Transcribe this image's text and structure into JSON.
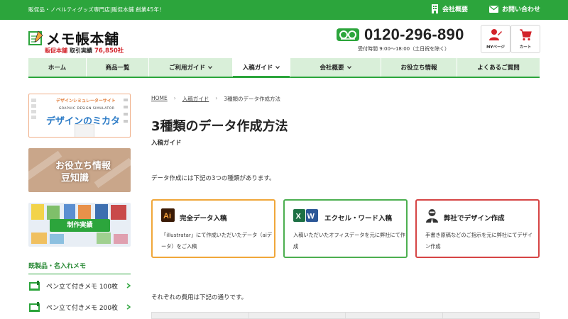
{
  "topbar": {
    "tagline": "販促品・ノベルティグッズ専門店|販促本舗 創業45年！",
    "company_link": "会社概要",
    "contact_link": "お問い合わせ"
  },
  "header": {
    "logo_title": "メモ帳本舗",
    "logo_brand": "販促本舗",
    "logo_record_label": "取引実績",
    "logo_record_count": "76,850社",
    "phone": "0120-296-890",
    "hours": "受付時間 9:00～18:00（土日祝を除く）",
    "mypage_label": "MYページ",
    "cart_label": "カート"
  },
  "nav": [
    {
      "label": "ホーム",
      "dropdown": false
    },
    {
      "label": "商品一覧",
      "dropdown": false
    },
    {
      "label": "ご利用ガイド",
      "dropdown": true
    },
    {
      "label": "入稿ガイド",
      "dropdown": true,
      "active": true
    },
    {
      "label": "会社概要",
      "dropdown": true
    },
    {
      "label": "お役立ち情報",
      "dropdown": false
    },
    {
      "label": "よくあるご質問",
      "dropdown": false
    }
  ],
  "sidebar": {
    "banner_design": {
      "top": "デザインシミュレーターサイト",
      "en": "GRAPHIC DESIGN SIMULATOR",
      "title": "デザインのミカタ"
    },
    "banner_tips": {
      "line1": "お役立ち情報",
      "line2": "豆知識"
    },
    "banner_works": {
      "label": "制作実績"
    },
    "heading": "既製品・名入れメモ",
    "items": [
      {
        "label": "ペン立て付きメモ 100枚"
      },
      {
        "label": "ペン立て付きメモ 200枚"
      }
    ]
  },
  "main": {
    "breadcrumb": [
      "HOME",
      "入稿ガイド",
      "3種類のデータ作成方法"
    ],
    "title": "3種類のデータ作成方法",
    "subtitle": "入稿ガイド",
    "intro": "データ作成には下記の3つの種類があります。",
    "cards": [
      {
        "title": "完全データ入稿",
        "desc": "「illustratar」にて作成いただいたデータ（aiデータ）をご入稿",
        "icon": "illustrator-icon",
        "color": "#f0a73a"
      },
      {
        "title": "エクセル・ワード入稿",
        "desc": "入稿いただいたオフィスデータを元に弊社にて作成",
        "icon": "excel-word-icon",
        "color": "#4caf50"
      },
      {
        "title": "弊社でデザイン作成",
        "desc": "手書き原稿などのご指示を元に弊社にてデザイン作成",
        "icon": "designer-icon",
        "color": "#d64545"
      }
    ],
    "cost_text": "それぞれの費用は下記の通りです。"
  },
  "colors": {
    "brand_green": "#2ca53c",
    "nav_bg": "#d9efd9",
    "accent_red": "#d2232a"
  }
}
